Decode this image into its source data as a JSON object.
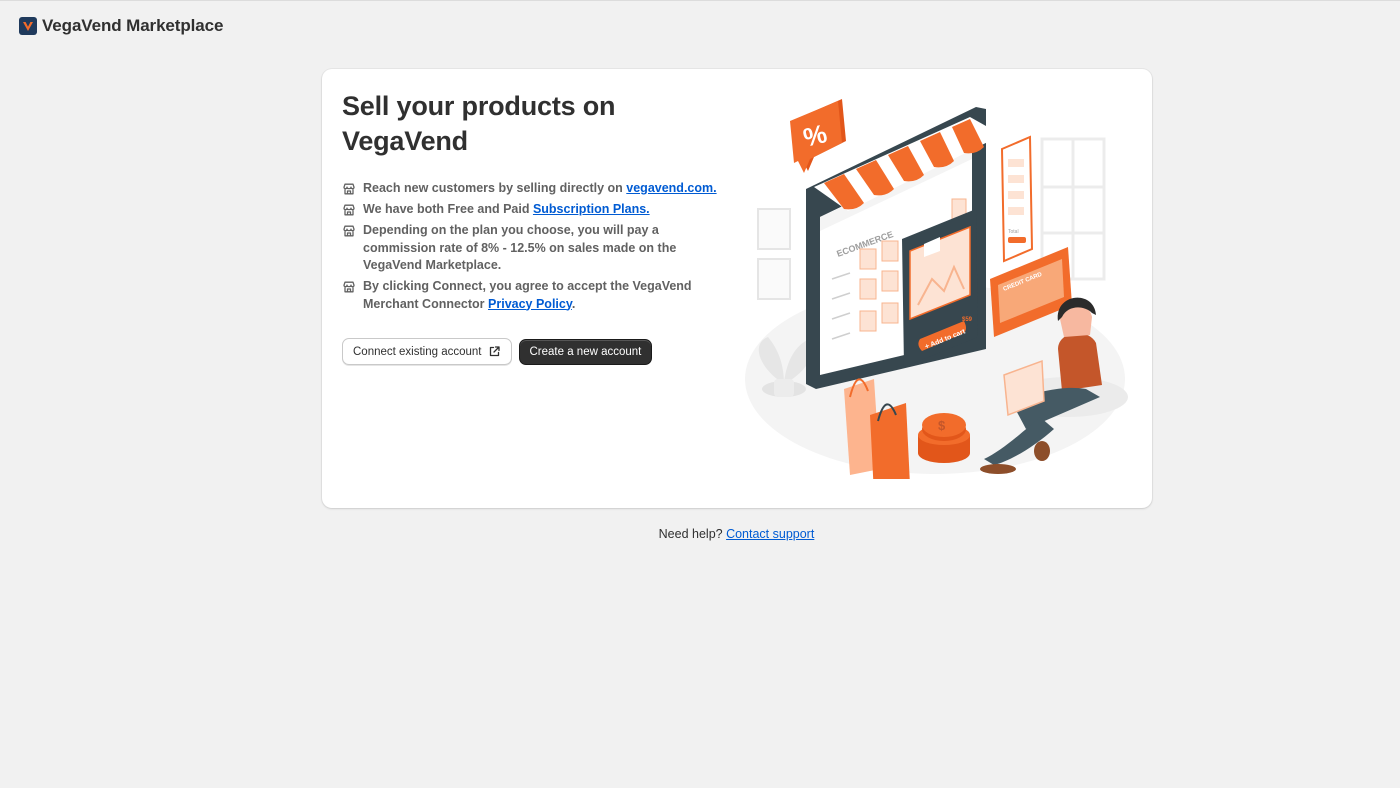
{
  "app": {
    "title": "VegaVend Marketplace",
    "logo_icon": "vegavend-logo-icon"
  },
  "card": {
    "headline": "Sell your products on VegaVend",
    "bullets": [
      {
        "text": "Reach new customers by selling directly on ",
        "link": "vegavend.com.",
        "tail": ""
      },
      {
        "text": "We have both Free and Paid ",
        "link": "Subscription Plans.",
        "tail": ""
      },
      {
        "text": "Depending on the plan you choose, you will pay a commission rate of 8% - 12.5% on sales made on the VegaVend Marketplace.",
        "link": "",
        "tail": ""
      },
      {
        "text": "By clicking Connect, you agree to accept the VegaVend Merchant Connector ",
        "link": "Privacy Policy",
        "tail": "."
      }
    ],
    "bullet_icon": "storefront-icon",
    "connect_label": "Connect existing account",
    "create_label": "Create a new account"
  },
  "illustration": {
    "awning_label": "ECOMMERCE",
    "percent": "%",
    "add_to_cart": "+ Add to cart",
    "price": "$59",
    "credit_card": "CREDIT CARD",
    "total": "Total",
    "coin_symbol": "$"
  },
  "footer": {
    "help_text": "Need help? ",
    "support_link": "Contact support"
  },
  "colors": {
    "accent": "#f26c2b",
    "primary_button": "#303030",
    "link": "#005bd3",
    "background": "#f1f1f1"
  }
}
